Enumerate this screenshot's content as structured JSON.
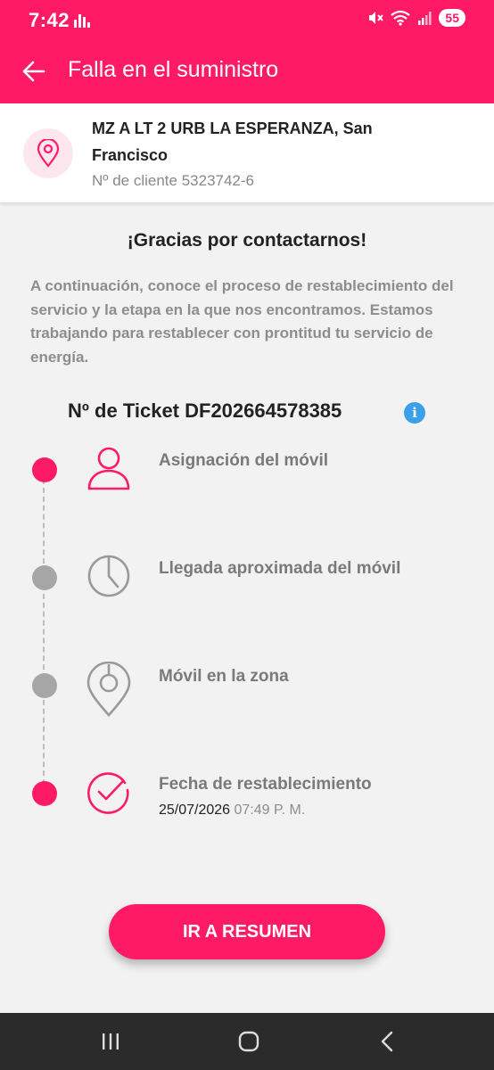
{
  "status_bar": {
    "time": "7:42",
    "battery": "55"
  },
  "app_bar": {
    "title": "Falla en el suministro"
  },
  "address": {
    "line1": "MZ A LT 2 URB LA ESPERANZA, San",
    "line2": "Francisco",
    "client": "Nº de cliente 5323742-6"
  },
  "main": {
    "thanks": "¡Gracias por contactarnos!",
    "intro": "A continuación, conoce el proceso de restablecimiento del servicio y la etapa en la que nos encontramos. Estamos trabajando para restablecer con prontitud tu servicio de energía.",
    "ticket": "Nº de Ticket DF202664578385"
  },
  "steps": [
    {
      "label": "Asignación del móvil",
      "icon": "user-icon",
      "state": "active"
    },
    {
      "label": "Llegada aproximada del móvil",
      "icon": "clock-icon",
      "state": "inactive"
    },
    {
      "label": "Móvil en la zona",
      "icon": "location-pin-icon",
      "state": "inactive"
    },
    {
      "label": "Fecha de restablecimiento",
      "icon": "check-circle-icon",
      "state": "active",
      "date": "25/07/2026",
      "time": "07:49 P. M."
    }
  ],
  "cta": {
    "label": "IR A RESUMEN"
  },
  "colors": {
    "brand": "#ff1a66",
    "inactive": "#a6a6a6",
    "info": "#3aa0ea"
  }
}
